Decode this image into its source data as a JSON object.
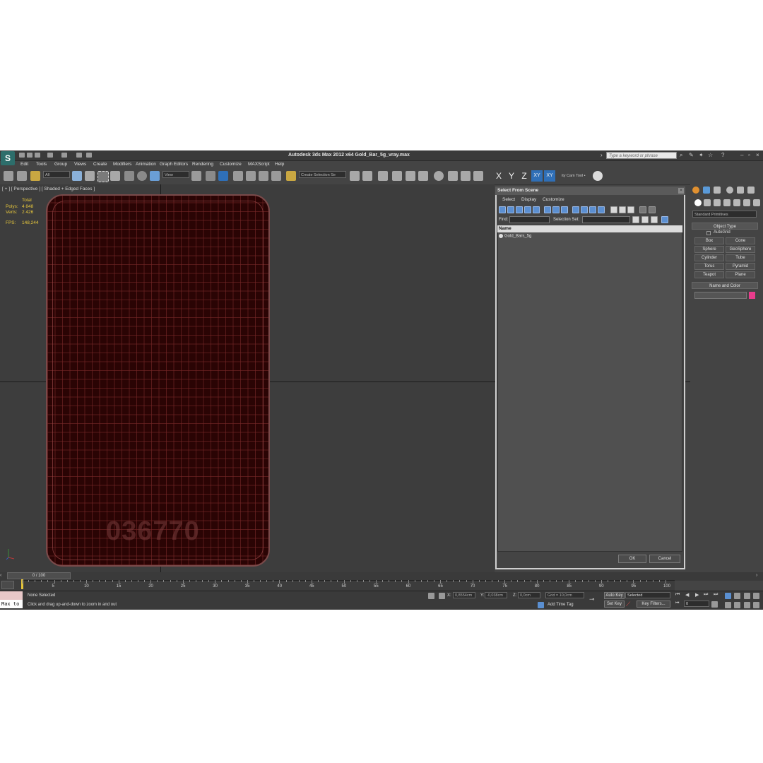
{
  "app": {
    "title": "Autodesk 3ds Max  2012 x64     Gold_Bar_5g_vray.max",
    "search_placeholder": "Type a keyword or phrase"
  },
  "menu": [
    "Edit",
    "Tools",
    "Group",
    "Views",
    "Create",
    "Modifiers",
    "Animation",
    "Graph Editors",
    "Rendering",
    "Customize",
    "MAXScript",
    "Help"
  ],
  "toolbar": {
    "filter_dropdown": "All",
    "refcoord_dropdown": "View",
    "selection_set_dropdown": "Create Selection Se",
    "axes": [
      "X",
      "Y",
      "Z",
      "XY",
      "XY"
    ],
    "camtool_label": "ity Cam Tool •"
  },
  "viewport": {
    "label": "[ + ] [ Perspective ] [ Shaded + Edged Faces ]",
    "stats": {
      "total_label": "Total",
      "polys_label": "Polys:",
      "polys_value": "4 848",
      "verts_label": "Verts:",
      "verts_value": "2 426",
      "fps_label": "FPS:",
      "fps_value": "148,244"
    },
    "engraving": "036770"
  },
  "dialog": {
    "title": "Select From Scene",
    "menu": [
      "Select",
      "Display",
      "Customize"
    ],
    "find_label": "Find:",
    "selection_set_label": "Selection Set:",
    "column_header": "Name",
    "items": [
      "Gold_Bars_5g"
    ],
    "ok_label": "OK",
    "cancel_label": "Cancel"
  },
  "command_panel": {
    "category_dropdown": "Standard Primitives",
    "object_type_title": "Object Type",
    "autogrid_label": "AutoGrid",
    "buttons": [
      "Box",
      "Cone",
      "Sphere",
      "GeoSphere",
      "Cylinder",
      "Tube",
      "Torus",
      "Pyramid",
      "Teapot",
      "Plane"
    ],
    "name_color_title": "Name and Color",
    "color_swatch": "#e83c8c"
  },
  "timeline": {
    "frame_counter": "0 / 100",
    "ticks": [
      "5",
      "10",
      "15",
      "20",
      "25",
      "30",
      "35",
      "40",
      "45",
      "50",
      "55",
      "60",
      "65",
      "70",
      "75",
      "80",
      "85",
      "90",
      "95",
      "100"
    ]
  },
  "status": {
    "maxscript_text": "Max to",
    "selection_status": "None Selected",
    "prompt": "Click and drag up-and-down to zoom in and out",
    "x_label": "X:",
    "x_value": "0,8554cm",
    "y_label": "Y:",
    "y_value": "-0,038cm",
    "z_label": "Z:",
    "z_value": "0,0cm",
    "grid": "Grid = 10,0cm",
    "add_time_tag": "Add Time Tag",
    "auto_key": "Auto Key",
    "set_key": "Set Key",
    "selected_dropdown": "Selected",
    "key_filters": "Key Filters...",
    "frame_field": "0"
  }
}
